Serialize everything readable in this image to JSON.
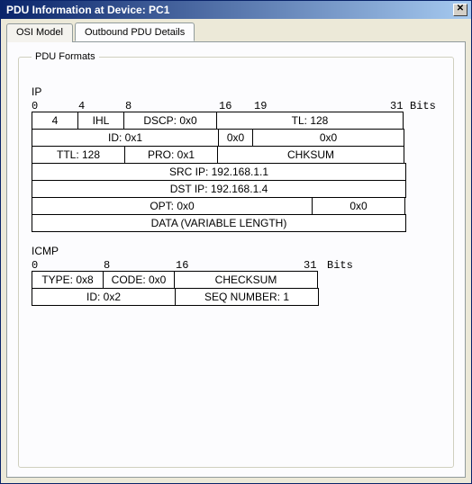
{
  "window": {
    "title": "PDU Information at Device: PC1"
  },
  "tabs": {
    "osi": "OSI Model",
    "outbound": "Outbound PDU Details"
  },
  "fieldset_legend": "PDU Formats",
  "ip": {
    "title": "IP",
    "ruler": {
      "p0": "0",
      "p4": "4",
      "p8": "8",
      "p16": "16",
      "p19": "19",
      "p31": "31"
    },
    "bits_label": "Bits",
    "version": "4",
    "ihl": "IHL",
    "dscp": "DSCP: 0x0",
    "tl": "TL: 128",
    "id": "ID: 0x1",
    "flags": "0x0",
    "frag": "0x0",
    "ttl": "TTL: 128",
    "proto": "PRO: 0x1",
    "chksum": "CHKSUM",
    "srcip": "SRC IP: 192.168.1.1",
    "dstip": "DST IP: 192.168.1.4",
    "opt": "OPT: 0x0",
    "pad": "0x0",
    "data": "DATA (VARIABLE LENGTH)"
  },
  "icmp": {
    "title": "ICMP",
    "ruler": {
      "p0": "0",
      "p8": "8",
      "p16": "16",
      "p31": "31"
    },
    "bits_label": "Bits",
    "type": "TYPE: 0x8",
    "code": "CODE: 0x0",
    "checksum": "CHECKSUM",
    "id": "ID: 0x2",
    "seq": "SEQ NUMBER: 1"
  }
}
